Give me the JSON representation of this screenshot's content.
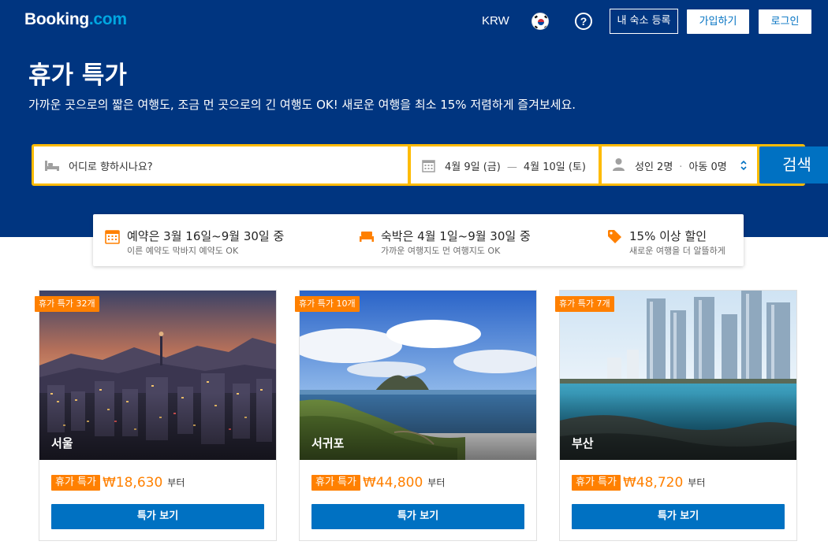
{
  "header": {
    "logo_main": "Booking",
    "logo_suffix": ".com",
    "currency": "KRW",
    "list_property": "내 숙소 등록",
    "signup": "가입하기",
    "login": "로그인",
    "help_glyph": "?"
  },
  "hero": {
    "title": "휴가 특가",
    "subtitle": "가까운 곳으로의 짧은 여행도, 조금 먼 곳으로의 긴 여행도 OK! 새로운 여행을 최소 15% 저렴하게 즐겨보세요."
  },
  "search": {
    "destination_placeholder": "어디로 향하시나요?",
    "checkin": "4월 9일 (금)",
    "date_separator": "—",
    "checkout": "4월 10일 (토)",
    "adults": "성인 2명",
    "guest_separator": "·",
    "children": "아동 0명",
    "submit": "검색"
  },
  "benefits": [
    {
      "icon": "calendar-icon",
      "title": "예약은 3월 16일~9월 30일 중",
      "desc": "이른 예약도 막바지 예약도 OK"
    },
    {
      "icon": "bed-icon",
      "title": "숙박은 4월 1일~9월 30일 중",
      "desc": "가까운 여행지도 먼 여행지도 OK"
    },
    {
      "icon": "price-tag-icon",
      "title": "15% 이상 할인",
      "desc": "새로운 여행을 더 알뜰하게"
    }
  ],
  "cards": [
    {
      "badge": "휴가 특가 32개",
      "city": "서울",
      "tag": "휴가 특가",
      "price": "₩18,630",
      "from": "부터",
      "button": "특가 보기"
    },
    {
      "badge": "휴가 특가 10개",
      "city": "서귀포",
      "tag": "휴가 특가",
      "price": "₩44,800",
      "from": "부터",
      "button": "특가 보기"
    },
    {
      "badge": "휴가 특가 7개",
      "city": "부산",
      "tag": "휴가 특가",
      "price": "₩48,720",
      "from": "부터",
      "button": "특가 보기"
    }
  ],
  "colors": {
    "brand_blue": "#003580",
    "action_blue": "#0071c2",
    "search_border": "#febb02",
    "deal_orange": "#ff8000"
  }
}
